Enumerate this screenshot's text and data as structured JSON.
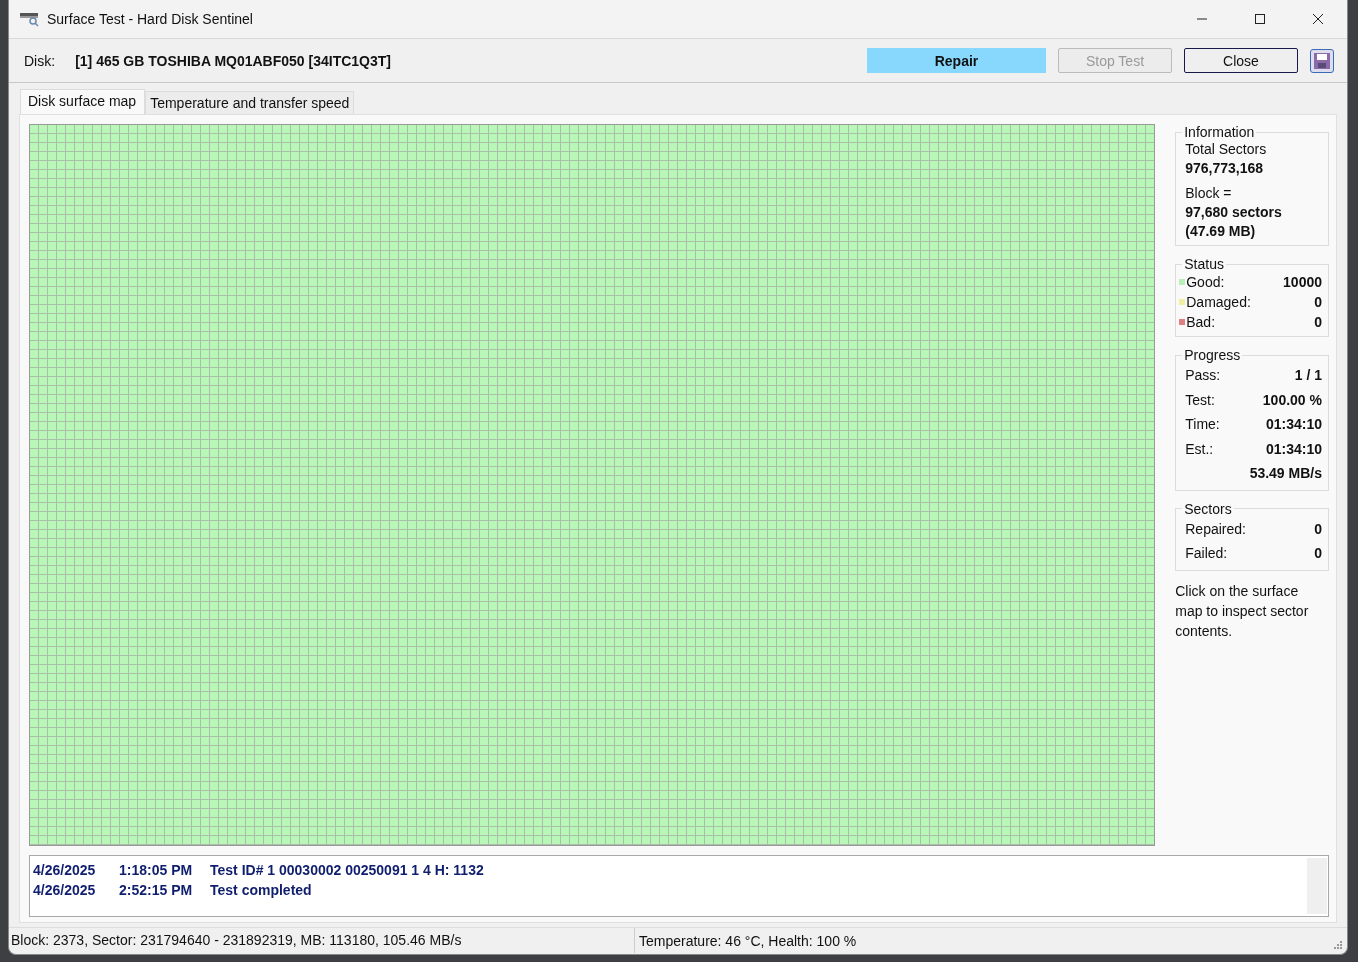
{
  "window": {
    "title": "Surface Test - Hard Disk Sentinel"
  },
  "disk": {
    "label": "Disk:",
    "name": "[1] 465 GB  TOSHIBA MQ01ABF050 [34ITC1Q3T]"
  },
  "buttons": [
    {
      "label": "Repair",
      "highlighted": true,
      "disabled": false,
      "focused": false
    },
    {
      "label": "Stop Test",
      "highlighted": false,
      "disabled": true,
      "focused": false
    },
    {
      "label": "Close",
      "highlighted": false,
      "disabled": false,
      "focused": true
    }
  ],
  "tabs": [
    {
      "label": "Disk surface map",
      "selected": true
    },
    {
      "label": "Temperature and transfer speed",
      "selected": false
    }
  ],
  "information": {
    "title": "Information",
    "total_label": "Total Sectors",
    "total_value": "976,773,168",
    "block_label": "Block =",
    "block_value": "97,680 sectors",
    "block_size": "(47.69 MB)"
  },
  "status": {
    "title": "Status",
    "items": [
      {
        "label": "Good:",
        "value": "10000",
        "color": "#b9f0b9"
      },
      {
        "label": "Damaged:",
        "value": "0",
        "color": "#f0f0a0"
      },
      {
        "label": "Bad:",
        "value": "0",
        "color": "#e08080"
      }
    ]
  },
  "progress": {
    "title": "Progress",
    "rows": [
      {
        "label": "Pass:",
        "value": "1 / 1"
      },
      {
        "label": "Test:",
        "value": "100.00 %"
      },
      {
        "label": "Time:",
        "value": "01:34:10"
      },
      {
        "label": "Est.:",
        "value": "01:34:10"
      },
      {
        "value": "53.49 MB/s"
      }
    ]
  },
  "sectors": {
    "title": "Sectors",
    "rows": [
      {
        "label": "Repaired:",
        "value": "0"
      },
      {
        "label": "Failed:",
        "value": "0"
      }
    ]
  },
  "hint": "Click on the surface map to inspect sector contents.",
  "log": [
    {
      "date": "4/26/2025",
      "time": "1:18:05 PM",
      "message": "Test ID# 1 00030002 00250091 1 4 H: 1132"
    },
    {
      "date": "4/26/2025",
      "time": "2:52:15 PM",
      "message": "Test completed"
    }
  ],
  "status_bar": {
    "block_info": "Block: 2373, Sector: 231794640 - 231892319, MB: 113180, 105.46 MB/s",
    "health_info": "Temperature: 46  °C,  Health: 100 %"
  }
}
